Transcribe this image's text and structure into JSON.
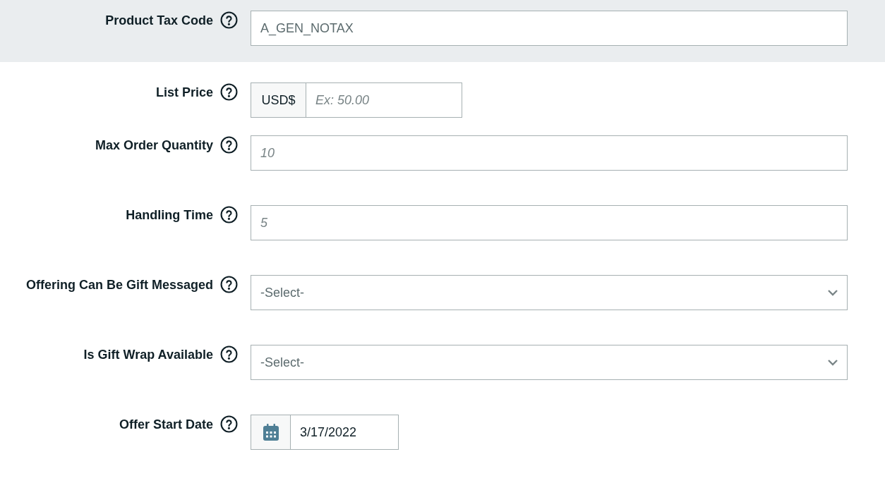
{
  "fields": [
    {
      "kind": "text",
      "label": "Product Tax Code",
      "value": "A_GEN_NOTAX",
      "highlighted": true
    },
    {
      "kind": "price",
      "label": "List Price",
      "prefix": "USD$",
      "placeholder": "Ex: 50.00",
      "highlighted": false
    },
    {
      "kind": "text",
      "label": "Max Order Quantity",
      "placeholder": "10",
      "highlighted": false
    },
    {
      "kind": "text",
      "label": "Handling Time",
      "placeholder": "5",
      "highlighted": false
    },
    {
      "kind": "select",
      "label": "Offering Can Be Gift Messaged",
      "value": "-Select-",
      "highlighted": false
    },
    {
      "kind": "select",
      "label": "Is Gift Wrap Available",
      "value": "-Select-",
      "highlighted": false
    },
    {
      "kind": "date",
      "label": "Offer Start Date",
      "value": "3/17/2022",
      "highlighted": false
    }
  ]
}
